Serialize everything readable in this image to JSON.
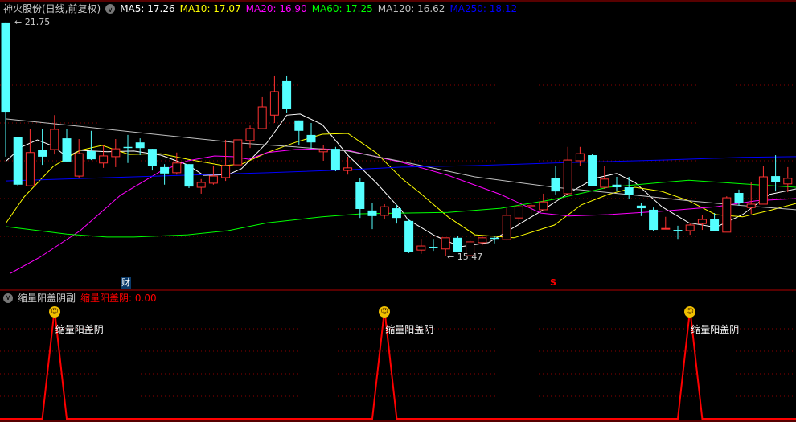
{
  "header": {
    "title": "神火股份(日线,前复权)",
    "toggle_icon": "chevron-down-icon",
    "ma": [
      {
        "label": "MA5: 17.26",
        "color": "#ffffff"
      },
      {
        "label": "MA10: 17.07",
        "color": "#ffff00"
      },
      {
        "label": "MA20: 16.90",
        "color": "#ff00ff"
      },
      {
        "label": "MA60: 17.25",
        "color": "#00ff00"
      },
      {
        "label": "MA120: 16.62",
        "color": "#c0c0c0"
      },
      {
        "label": "MA250: 18.12",
        "color": "#0000ff"
      }
    ]
  },
  "annotations": {
    "high_label": "21.75",
    "low_label": "15.47",
    "cai": "财",
    "s": "S"
  },
  "sub": {
    "title": "缩量阳盖阴副",
    "value_label": "缩量阳盖阴: 0.00",
    "signal_label": "缩量阳盖阴",
    "signal_icon": "smiley-icon"
  },
  "colors": {
    "up": "#ff3232",
    "down": "#54ffff",
    "grid": "#8b0000",
    "signal": "#ff0000"
  },
  "chart_data": {
    "type": "candlestick",
    "price_range": [
      14.5,
      22.0
    ],
    "candles_ohlc": [
      [
        21.75,
        21.75,
        18.16,
        19.36
      ],
      [
        18.69,
        18.69,
        17.38,
        17.41
      ],
      [
        17.38,
        18.91,
        17.38,
        18.27
      ],
      [
        18.35,
        18.91,
        17.94,
        18.16
      ],
      [
        18.35,
        19.27,
        18.22,
        18.89
      ],
      [
        18.65,
        18.89,
        18.03,
        18.03
      ],
      [
        17.64,
        18.63,
        17.6,
        18.24
      ],
      [
        18.31,
        18.85,
        18.07,
        18.09
      ],
      [
        17.99,
        18.48,
        17.86,
        18.18
      ],
      [
        18.16,
        18.63,
        17.88,
        18.37
      ],
      [
        18.42,
        18.74,
        17.99,
        18.39
      ],
      [
        18.54,
        18.65,
        18.2,
        18.39
      ],
      [
        18.37,
        18.37,
        17.79,
        17.92
      ],
      [
        17.88,
        17.96,
        17.41,
        17.71
      ],
      [
        17.73,
        18.27,
        17.68,
        17.99
      ],
      [
        17.96,
        17.96,
        17.32,
        17.36
      ],
      [
        17.34,
        17.56,
        17.17,
        17.47
      ],
      [
        17.45,
        17.92,
        17.41,
        17.64
      ],
      [
        17.6,
        18.61,
        17.51,
        17.92
      ],
      [
        17.94,
        18.61,
        17.94,
        18.61
      ],
      [
        18.59,
        18.99,
        18.39,
        18.91
      ],
      [
        18.91,
        19.75,
        18.89,
        19.49
      ],
      [
        19.27,
        20.33,
        19.06,
        19.9
      ],
      [
        20.18,
        20.33,
        19.32,
        19.43
      ],
      [
        19.13,
        19.13,
        18.48,
        18.85
      ],
      [
        18.74,
        19.06,
        18.37,
        18.54
      ],
      [
        18.29,
        18.46,
        18.05,
        18.35
      ],
      [
        18.37,
        18.42,
        17.77,
        17.81
      ],
      [
        17.79,
        18.16,
        17.68,
        17.86
      ],
      [
        17.47,
        17.58,
        16.52,
        16.76
      ],
      [
        16.72,
        16.91,
        16.22,
        16.57
      ],
      [
        16.59,
        16.89,
        16.48,
        16.82
      ],
      [
        16.78,
        16.87,
        16.37,
        16.52
      ],
      [
        16.44,
        16.5,
        15.58,
        15.62
      ],
      [
        15.66,
        15.96,
        15.56,
        15.77
      ],
      [
        15.75,
        15.96,
        15.64,
        15.73
      ],
      [
        15.69,
        15.99,
        15.51,
        15.99
      ],
      [
        15.99,
        16.03,
        15.6,
        15.62
      ],
      [
        15.51,
        15.92,
        15.47,
        15.88
      ],
      [
        15.86,
        16.01,
        15.79,
        15.99
      ],
      [
        15.99,
        16.05,
        15.84,
        15.96
      ],
      [
        15.94,
        16.78,
        15.92,
        16.59
      ],
      [
        16.52,
        16.91,
        16.27,
        16.82
      ],
      [
        16.82,
        16.91,
        16.61,
        16.85
      ],
      [
        16.74,
        17.17,
        16.74,
        16.95
      ],
      [
        17.58,
        17.9,
        17.15,
        17.23
      ],
      [
        17.17,
        18.42,
        17.17,
        18.07
      ],
      [
        18.05,
        18.42,
        17.9,
        18.24
      ],
      [
        18.2,
        18.24,
        17.38,
        17.38
      ],
      [
        17.34,
        17.9,
        17.3,
        17.56
      ],
      [
        17.41,
        17.62,
        17.23,
        17.34
      ],
      [
        17.34,
        17.62,
        17.04,
        17.13
      ],
      [
        16.85,
        16.93,
        16.57,
        16.78
      ],
      [
        16.74,
        16.8,
        16.18,
        16.2
      ],
      [
        16.22,
        16.55,
        16.22,
        16.24
      ],
      [
        16.2,
        16.31,
        15.96,
        16.18
      ],
      [
        16.18,
        16.39,
        16.07,
        16.33
      ],
      [
        16.37,
        16.59,
        16.2,
        16.48
      ],
      [
        16.48,
        16.65,
        16.16,
        16.16
      ],
      [
        16.14,
        17.1,
        16.14,
        17.06
      ],
      [
        17.19,
        17.28,
        16.85,
        16.93
      ],
      [
        16.8,
        17.47,
        16.63,
        16.89
      ],
      [
        16.89,
        17.92,
        16.89,
        17.62
      ],
      [
        17.64,
        18.2,
        17.23,
        17.47
      ],
      [
        17.43,
        17.88,
        17.21,
        17.58
      ]
    ],
    "ma_series": [
      {
        "name": "MA5",
        "color": "#ffffff",
        "points": [
          [
            0,
            18.03
          ],
          [
            1.3,
            18.42
          ],
          [
            2.6,
            18.61
          ],
          [
            3.9,
            18.44
          ],
          [
            5.0,
            18.16
          ],
          [
            6.1,
            18.33
          ],
          [
            8.3,
            18.29
          ],
          [
            10.5,
            18.31
          ],
          [
            12.7,
            18.2
          ],
          [
            14.9,
            17.94
          ],
          [
            16.2,
            17.66
          ],
          [
            18.2,
            17.68
          ],
          [
            19.3,
            17.84
          ],
          [
            21.4,
            18.54
          ],
          [
            23.0,
            19.27
          ],
          [
            24.1,
            19.3
          ],
          [
            25.9,
            19.02
          ],
          [
            28.0,
            18.2
          ],
          [
            30.3,
            17.47
          ],
          [
            32.4,
            16.72
          ],
          [
            32.9,
            16.48
          ],
          [
            35.1,
            16.05
          ],
          [
            37.2,
            15.75
          ],
          [
            39.5,
            15.86
          ],
          [
            41.6,
            16.27
          ],
          [
            43.8,
            16.7
          ],
          [
            46.1,
            17.19
          ],
          [
            48.2,
            17.58
          ],
          [
            50.0,
            17.71
          ],
          [
            51.5,
            17.47
          ],
          [
            53.7,
            16.82
          ],
          [
            55.9,
            16.39
          ],
          [
            58.1,
            16.27
          ],
          [
            60.3,
            16.61
          ],
          [
            62.5,
            17.15
          ],
          [
            64.7,
            17.3
          ]
        ]
      },
      {
        "name": "MA10",
        "color": "#ffff00",
        "points": [
          [
            0,
            16.37
          ],
          [
            1.5,
            17.08
          ],
          [
            3.9,
            17.9
          ],
          [
            6.1,
            18.33
          ],
          [
            7.9,
            18.46
          ],
          [
            10.1,
            18.22
          ],
          [
            12.7,
            18.24
          ],
          [
            14.9,
            18.09
          ],
          [
            17.8,
            17.92
          ],
          [
            19.3,
            17.96
          ],
          [
            21.4,
            18.27
          ],
          [
            23.7,
            18.54
          ],
          [
            25.9,
            18.76
          ],
          [
            28.0,
            18.78
          ],
          [
            30.3,
            18.27
          ],
          [
            32.4,
            17.58
          ],
          [
            33.9,
            17.19
          ],
          [
            36.2,
            16.55
          ],
          [
            38.4,
            16.07
          ],
          [
            41.6,
            15.99
          ],
          [
            44.9,
            16.33
          ],
          [
            47.1,
            16.87
          ],
          [
            49.3,
            17.15
          ],
          [
            51.5,
            17.34
          ],
          [
            53.7,
            17.23
          ],
          [
            55.9,
            16.98
          ],
          [
            58.1,
            16.61
          ],
          [
            60.3,
            16.55
          ],
          [
            62.5,
            16.72
          ],
          [
            64.7,
            16.91
          ]
        ]
      },
      {
        "name": "MA20",
        "color": "#ff00ff",
        "points": [
          [
            0.4,
            15.04
          ],
          [
            2.8,
            15.47
          ],
          [
            6.1,
            16.18
          ],
          [
            9.4,
            17.13
          ],
          [
            12.7,
            17.77
          ],
          [
            14.9,
            18.05
          ],
          [
            17.1,
            18.18
          ],
          [
            18.6,
            18.16
          ],
          [
            19.9,
            18.09
          ],
          [
            21.4,
            18.27
          ],
          [
            23.7,
            18.35
          ],
          [
            25.9,
            18.37
          ],
          [
            28.0,
            18.33
          ],
          [
            30.3,
            18.16
          ],
          [
            32.4,
            18.01
          ],
          [
            36.2,
            17.66
          ],
          [
            40.5,
            17.15
          ],
          [
            43.8,
            16.65
          ],
          [
            46.1,
            16.57
          ],
          [
            49.3,
            16.61
          ],
          [
            53.7,
            16.7
          ],
          [
            58.1,
            16.82
          ],
          [
            61.4,
            16.98
          ],
          [
            64.7,
            17.04
          ]
        ]
      },
      {
        "name": "MA60",
        "color": "#00ff00",
        "points": [
          [
            0,
            16.29
          ],
          [
            5.0,
            16.09
          ],
          [
            8.3,
            16.01
          ],
          [
            10.5,
            16.01
          ],
          [
            14.9,
            16.07
          ],
          [
            18.2,
            16.18
          ],
          [
            21.4,
            16.39
          ],
          [
            25.9,
            16.55
          ],
          [
            29.1,
            16.63
          ],
          [
            32.4,
            16.65
          ],
          [
            36.2,
            16.67
          ],
          [
            40.5,
            16.78
          ],
          [
            44.9,
            17.02
          ],
          [
            49.3,
            17.34
          ],
          [
            53.7,
            17.47
          ],
          [
            55.9,
            17.53
          ],
          [
            60.3,
            17.43
          ],
          [
            64.7,
            17.34
          ]
        ]
      },
      {
        "name": "MA120",
        "color": "#c0c0c0",
        "points": [
          [
            0,
            19.17
          ],
          [
            6.1,
            18.97
          ],
          [
            12.7,
            18.74
          ],
          [
            19.3,
            18.52
          ],
          [
            23.7,
            18.42
          ],
          [
            28.0,
            18.31
          ],
          [
            32.4,
            18.03
          ],
          [
            38.4,
            17.62
          ],
          [
            44.9,
            17.34
          ],
          [
            51.5,
            17.13
          ],
          [
            55.9,
            16.98
          ],
          [
            60.3,
            16.85
          ],
          [
            64.7,
            16.74
          ]
        ]
      },
      {
        "name": "MA250",
        "color": "#0000ff",
        "points": [
          [
            0,
            17.51
          ],
          [
            10.5,
            17.62
          ],
          [
            21.4,
            17.73
          ],
          [
            28.0,
            17.81
          ],
          [
            32.4,
            17.88
          ],
          [
            38.4,
            17.92
          ],
          [
            44.9,
            17.99
          ],
          [
            53.7,
            18.07
          ],
          [
            60.3,
            18.14
          ],
          [
            64.7,
            18.16
          ]
        ]
      }
    ],
    "signal": {
      "name": "缩量阳盖阴",
      "range": [
        0,
        1
      ],
      "hits": [
        4,
        31,
        56
      ]
    }
  }
}
